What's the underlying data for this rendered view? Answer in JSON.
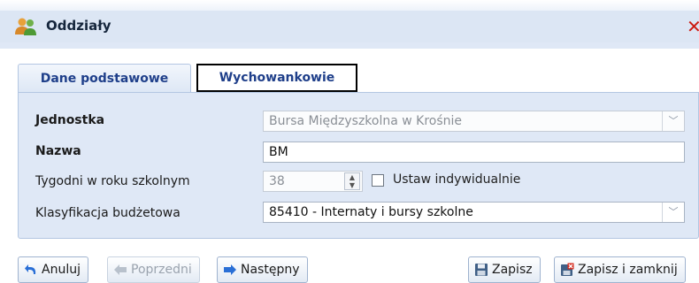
{
  "window": {
    "title": "Oddziały"
  },
  "tabs": [
    {
      "label": "Dane podstawowe",
      "active": true
    },
    {
      "label": "Wychowankowie",
      "active": false
    }
  ],
  "form": {
    "jednostka": {
      "label": "Jednostka",
      "value": "Bursa Międzyszkolna w Krośnie",
      "disabled": true
    },
    "nazwa": {
      "label": "Nazwa",
      "value": "BM"
    },
    "tygodnie": {
      "label": "Tygodni w roku szkolnym",
      "value": "38",
      "disabled": true
    },
    "ustaw": {
      "label": "Ustaw indywidualnie",
      "checked": false
    },
    "klasyfikacja": {
      "label": "Klasyfikacja budżetowa",
      "value": "85410 - Internaty i bursy szkolne"
    }
  },
  "buttons": {
    "cancel": "Anuluj",
    "previous": "Poprzedni",
    "next": "Następny",
    "save": "Zapisz",
    "save_close": "Zapisz i zamknij"
  },
  "icons": {
    "window": "users-icon",
    "close": "close-icon",
    "cancel": "undo-icon",
    "previous": "arrow-left-icon",
    "next": "arrow-right-icon",
    "save": "floppy-disk-icon",
    "save_close": "floppy-disk-close-icon"
  },
  "colors": {
    "panel": "#dfe8f6",
    "tab_text": "#1f3f8a",
    "close": "#cc1a10",
    "arrow": "#2a6fd6"
  }
}
